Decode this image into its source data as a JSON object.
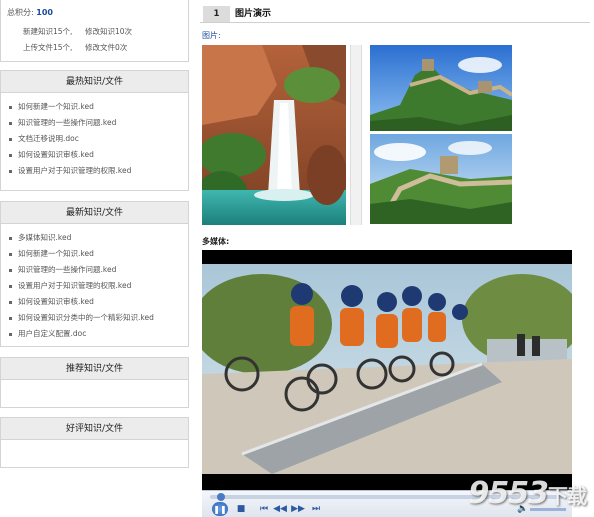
{
  "summary": {
    "score_label": "总积分:",
    "score_value": "100",
    "new_knowledge": "新建知识15个,",
    "edit_knowledge": "修改知识10次",
    "upload_files": "上传文件15个,",
    "edit_files": "修改文件0次"
  },
  "hot_panel": {
    "title": "最热知识/文件",
    "items": [
      "如何新建一个知识.ked",
      "知识管理的一些操作问题.ked",
      "文档迁移说明.doc",
      "如何设置知识审核.ked",
      "设置用户对于知识管理的权限.ked"
    ]
  },
  "newest_panel": {
    "title": "最新知识/文件",
    "items": [
      "多媒体知识.ked",
      "如何新建一个知识.ked",
      "知识管理的一些操作问题.ked",
      "设置用户对于知识管理的权限.ked",
      "如何设置知识审核.ked",
      "如何设置知识分类中的一个精彩知识.ked",
      "用户自定义配置.doc"
    ]
  },
  "recommend_panel": {
    "title": "推荐知识/文件"
  },
  "praise_panel": {
    "title": "好评知识/文件"
  },
  "main": {
    "section_number": "1",
    "section_title": "图片演示",
    "pictures_label": "图片:",
    "multimedia_label": "多媒体:"
  },
  "player": {
    "progress": 0.02
  },
  "watermark": {
    "text": "9553",
    "suffix": "下载"
  },
  "colors": {
    "link_blue": "#1a4a9c",
    "panel_head_bg": "#ececec",
    "border": "#d4d4d4"
  }
}
